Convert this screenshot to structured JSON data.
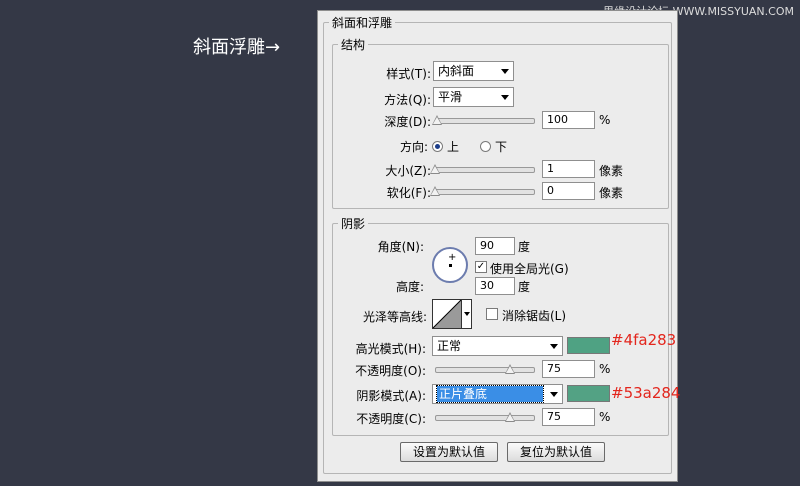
{
  "watermark": "思缘设计论坛 WWW.MISSYUAN.COM",
  "side_label": "斜面浮雕→",
  "dialog": {
    "title": "斜面和浮雕",
    "structure": {
      "legend": "结构",
      "style_label": "样式(T):",
      "style_value": "内斜面",
      "technique_label": "方法(Q):",
      "technique_value": "平滑",
      "depth_label": "深度(D):",
      "depth_value": "100",
      "depth_unit": "%",
      "depth_slider_fraction": 0.02,
      "direction_label": "方向:",
      "direction_up": "上",
      "direction_down": "下",
      "direction_selected": "上",
      "size_label": "大小(Z):",
      "size_value": "1",
      "size_unit": "像素",
      "size_slider_fraction": 0.0,
      "soften_label": "软化(F):",
      "soften_value": "0",
      "soften_unit": "像素",
      "soften_slider_fraction": 0.0
    },
    "shading": {
      "legend": "阴影",
      "angle_label": "角度(N):",
      "angle_value": "90",
      "angle_unit": "度",
      "global_light_label": "使用全局光(G)",
      "global_light_checked": true,
      "altitude_label": "高度:",
      "altitude_value": "30",
      "altitude_unit": "度",
      "gloss_contour_label": "光泽等高线:",
      "anti_alias_label": "消除锯齿(L)",
      "anti_alias_checked": false,
      "highlight_mode_label": "高光模式(H):",
      "highlight_mode_value": "正常",
      "highlight_color": "#4fa283",
      "highlight_color_annotation": "#4fa283",
      "highlight_opacity_label": "不透明度(O):",
      "highlight_opacity_value": "75",
      "highlight_opacity_unit": "%",
      "highlight_opacity_fraction": 0.75,
      "shadow_mode_label": "阴影模式(A):",
      "shadow_mode_value": "正片叠底",
      "shadow_color": "#53a284",
      "shadow_color_annotation": "#53a284",
      "shadow_opacity_label": "不透明度(C):",
      "shadow_opacity_value": "75",
      "shadow_opacity_unit": "%",
      "shadow_opacity_fraction": 0.75
    },
    "buttons": {
      "make_default": "设置为默认值",
      "reset_default": "复位为默认值"
    }
  }
}
